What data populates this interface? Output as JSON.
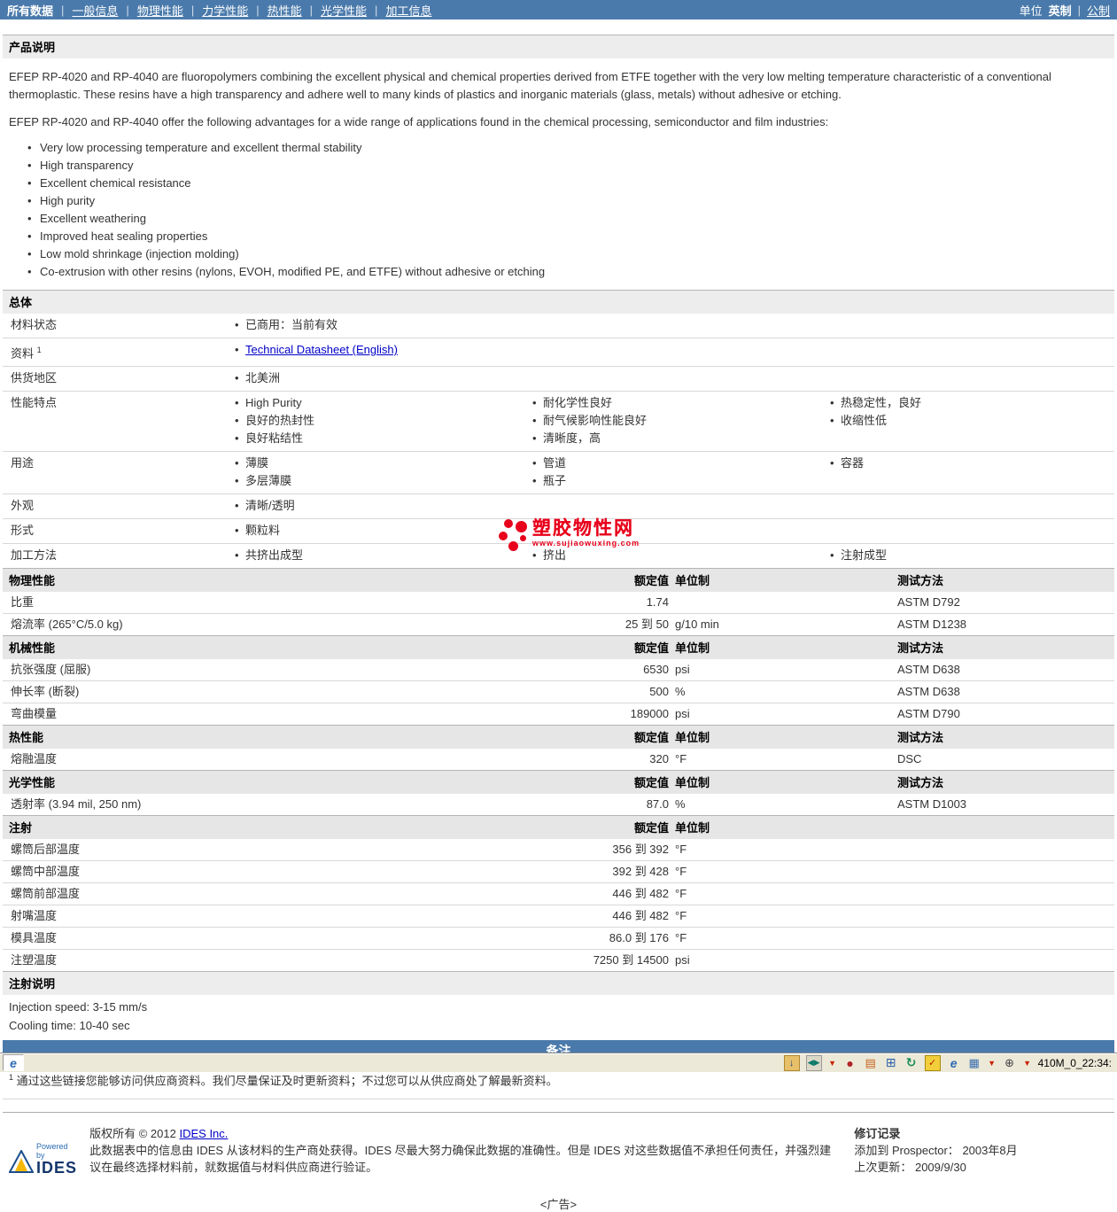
{
  "nav": {
    "items": [
      {
        "label": "所有数据",
        "active": true
      },
      {
        "label": "一般信息",
        "active": false
      },
      {
        "label": "物理性能",
        "active": false
      },
      {
        "label": "力学性能",
        "active": false
      },
      {
        "label": "热性能",
        "active": false
      },
      {
        "label": "光学性能",
        "active": false
      },
      {
        "label": "加工信息",
        "active": false
      }
    ],
    "unit_label": "单位",
    "unit_imperial": "英制",
    "unit_metric": "公制"
  },
  "colors": {
    "accent_blue": "#4a7aab",
    "link_blue": "#0000c8",
    "watermark_red": "#e8001c"
  },
  "product_description": {
    "title": "产品说明",
    "paragraph1": "EFEP RP-4020 and RP-4040 are fluoropolymers combining the excellent physical and chemical properties derived from ETFE together with the very low melting temperature characteristic of a conventional thermoplastic. These resins have a high transparency and adhere well to many kinds of plastics and inorganic materials (glass, metals) without adhesive or etching.",
    "paragraph2": "EFEP RP-4020 and RP-4040 offer the following advantages for a wide range of applications found in the chemical processing, semiconductor and film industries:",
    "bullets": [
      "Very low processing temperature and excellent thermal stability",
      "High transparency",
      "Excellent chemical resistance",
      "High purity",
      "Excellent weathering",
      "Improved heat sealing properties",
      "Low mold shrinkage (injection molding)",
      "Co-extrusion with other resins (nylons, EVOH, modified PE, and ETFE) without adhesive or etching"
    ]
  },
  "general": {
    "title": "总体",
    "rows": [
      {
        "label": "材料状态",
        "c1": [
          "已商用：当前有效"
        ],
        "c2": [],
        "c3": []
      },
      {
        "label": "资料",
        "sup": "1",
        "link": "Technical Datasheet (English)",
        "c2": [],
        "c3": []
      },
      {
        "label": "供货地区",
        "c1": [
          "北美洲"
        ],
        "c2": [],
        "c3": []
      },
      {
        "label": "性能特点",
        "c1": [
          "High Purity",
          "良好的热封性",
          "良好粘结性"
        ],
        "c2": [
          "耐化学性良好",
          "耐气候影响性能良好",
          "清晰度，高"
        ],
        "c3": [
          "热稳定性，良好",
          "收缩性低"
        ]
      },
      {
        "label": "用途",
        "c1": [
          "薄膜",
          "多层薄膜"
        ],
        "c2": [
          "管道",
          "瓶子"
        ],
        "c3": [
          "容器"
        ]
      },
      {
        "label": "外观",
        "c1": [
          "清晰/透明"
        ],
        "c2": [],
        "c3": []
      },
      {
        "label": "形式",
        "c1": [
          "颗粒料"
        ],
        "c2": [],
        "c3": []
      },
      {
        "label": "加工方法",
        "c1": [
          "共挤出成型"
        ],
        "c2": [
          "挤出"
        ],
        "c3": [
          "注射成型"
        ]
      }
    ]
  },
  "tables": {
    "headers": {
      "value": "额定值",
      "unit": "单位制",
      "method": "测试方法"
    },
    "physical": {
      "title": "物理性能",
      "rows": [
        {
          "label": "比重",
          "value": "1.74",
          "unit": "",
          "method": "ASTM D792"
        },
        {
          "label": "熔流率 (265°C/5.0 kg)",
          "value": "25 到 50",
          "unit": "g/10 min",
          "method": "ASTM D1238"
        }
      ]
    },
    "mechanical": {
      "title": "机械性能",
      "rows": [
        {
          "label": "抗张强度 (屈服)",
          "value": "6530",
          "unit": "psi",
          "method": "ASTM D638"
        },
        {
          "label": "伸长率 (断裂)",
          "value": "500",
          "unit": "%",
          "method": "ASTM D638"
        },
        {
          "label": "弯曲模量",
          "value": "189000",
          "unit": "psi",
          "method": "ASTM D790"
        }
      ]
    },
    "thermal": {
      "title": "热性能",
      "rows": [
        {
          "label": "熔融温度",
          "value": "320",
          "unit": "°F",
          "method": "DSC"
        }
      ]
    },
    "optical": {
      "title": "光学性能",
      "rows": [
        {
          "label": "透射率 (3.94 mil, 250 nm)",
          "value": "87.0",
          "unit": "%",
          "method": "ASTM D1003"
        }
      ]
    },
    "injection": {
      "title": "注射",
      "rows": [
        {
          "label": "螺筒后部温度",
          "value": "356 到 392",
          "unit": "°F"
        },
        {
          "label": "螺筒中部温度",
          "value": "392 到 428",
          "unit": "°F"
        },
        {
          "label": "螺筒前部温度",
          "value": "446 到 482",
          "unit": "°F"
        },
        {
          "label": "射嘴温度",
          "value": "446 到 482",
          "unit": "°F"
        },
        {
          "label": "模具温度",
          "value": "86.0 到 176",
          "unit": "°F"
        },
        {
          "label": "注塑温度",
          "value": "7250 到 14500",
          "unit": "psi"
        }
      ]
    }
  },
  "injection_notes": {
    "title": "注射说明",
    "lines": [
      "Injection speed: 3-15 mm/s",
      "Cooling time: 10-40 sec"
    ]
  },
  "remarks": {
    "bar_label": "备注",
    "footnote_marker": "1",
    "footnote": "通过这些链接您能够访问供应商资料。我们尽量保证及时更新资料；不过您可以从供应商处了解最新资料。"
  },
  "footer": {
    "logo_powered_by": "Powered by",
    "logo_name": "IDES",
    "copyright_label": "版权所有",
    "copyright_year": "© 2012",
    "copyright_link": "IDES Inc.",
    "disclaimer": "此数据表中的信息由 IDES 从该材料的生产商处获得。IDES 尽最大努力确保此数据的准确性。但是 IDES 对这些数据值不承担任何责任，并强烈建议在最终选择材料前，就数据值与材料供应商进行验证。",
    "revision": {
      "title": "修订记录",
      "added_label": "添加到 Prospector：",
      "added_value": "2003年8月",
      "updated_label": "上次更新：",
      "updated_value": "2009/9/30"
    }
  },
  "ad_placeholder": "<广告>",
  "watermark": {
    "text": "塑胶物性网",
    "url": "www.sujiaowuxing.com"
  },
  "statusbar": {
    "right_text": "410M_0_22:34:",
    "icons": {
      "download": "↓",
      "media": "◀▶",
      "dropdown": "▼",
      "globe": "●",
      "page": "▤",
      "window": "⊞",
      "refresh": "↻",
      "clipboard": "✓",
      "ie": "e",
      "cascade": "▦",
      "zoom": "⊕"
    }
  }
}
